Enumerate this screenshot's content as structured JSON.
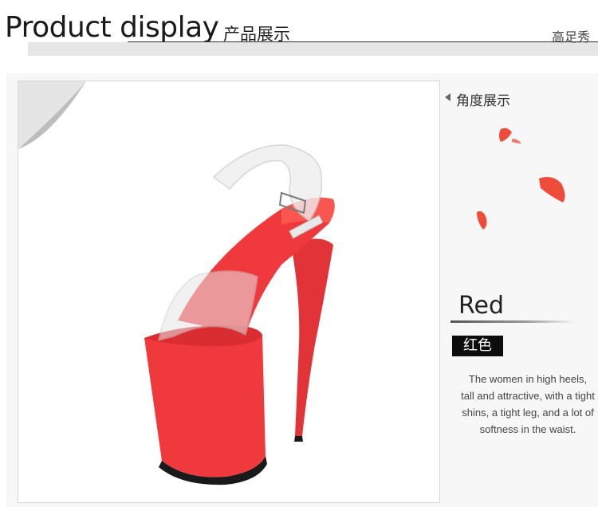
{
  "header": {
    "title_en": "Product display",
    "title_cn": "产品展示",
    "brand": "高足秀"
  },
  "side": {
    "angle_label": "角度展示",
    "color_en": "Red",
    "color_cn": "红色",
    "description": "The women in high heels, tall and attractive, with a tight shins, a tight leg, and a lot of softness in the waist."
  },
  "colors": {
    "shoe_red": "#f0393d",
    "petal": "#ef4b3a",
    "label_bg": "#0d0d0d"
  }
}
